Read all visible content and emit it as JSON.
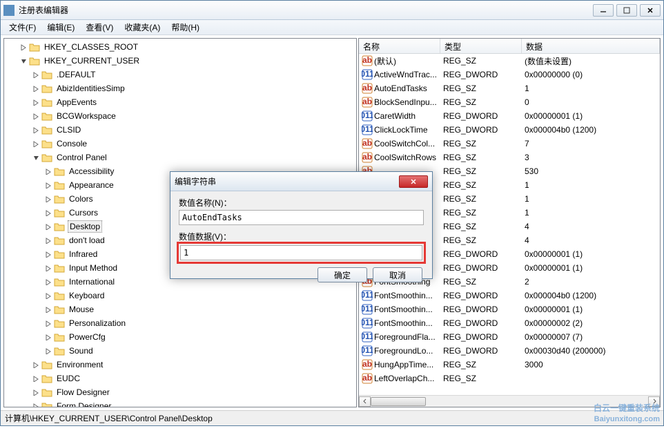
{
  "window": {
    "title": "注册表编辑器"
  },
  "menu": {
    "file": "文件(F)",
    "edit": "编辑(E)",
    "view": "查看(V)",
    "favorites": "收藏夹(A)",
    "help": "帮助(H)"
  },
  "tree": {
    "root1": "HKEY_CLASSES_ROOT",
    "root2": "HKEY_CURRENT_USER",
    "items": [
      ".DEFAULT",
      "AbizIdentitiesSimp",
      "AppEvents",
      "BCGWorkspace",
      "CLSID",
      "Console",
      "Control Panel"
    ],
    "cp_children": [
      "Accessibility",
      "Appearance",
      "Colors",
      "Cursors",
      "Desktop",
      "don't load",
      "Infrared",
      "Input Method",
      "International",
      "Keyboard",
      "Mouse",
      "Personalization",
      "PowerCfg",
      "Sound"
    ],
    "after_cp": [
      "Environment",
      "EUDC",
      "Flow Designer",
      "Form Designer"
    ],
    "selected": "Desktop"
  },
  "columns": {
    "name": "名称",
    "type": "类型",
    "data": "数据"
  },
  "rows": [
    {
      "icon": "sz",
      "name": "(默认)",
      "type": "REG_SZ",
      "data": "(数值未设置)"
    },
    {
      "icon": "dw",
      "name": "ActiveWndTrac...",
      "type": "REG_DWORD",
      "data": "0x00000000 (0)"
    },
    {
      "icon": "sz",
      "name": "AutoEndTasks",
      "type": "REG_SZ",
      "data": "1"
    },
    {
      "icon": "sz",
      "name": "BlockSendInpu...",
      "type": "REG_SZ",
      "data": "0"
    },
    {
      "icon": "dw",
      "name": "CaretWidth",
      "type": "REG_DWORD",
      "data": "0x00000001 (1)"
    },
    {
      "icon": "dw",
      "name": "ClickLockTime",
      "type": "REG_DWORD",
      "data": "0x000004b0 (1200)"
    },
    {
      "icon": "sz",
      "name": "CoolSwitchCol...",
      "type": "REG_SZ",
      "data": "7"
    },
    {
      "icon": "sz",
      "name": "CoolSwitchRows",
      "type": "REG_SZ",
      "data": "3"
    },
    {
      "icon": "sz",
      "name": "",
      "type": "REG_SZ",
      "data": "530"
    },
    {
      "icon": "sz",
      "name": "",
      "type": "REG_SZ",
      "data": "1"
    },
    {
      "icon": "sz",
      "name": "",
      "type": "REG_SZ",
      "data": "1"
    },
    {
      "icon": "sz",
      "name": "",
      "type": "REG_SZ",
      "data": "1"
    },
    {
      "icon": "sz",
      "name": "",
      "type": "REG_SZ",
      "data": "4"
    },
    {
      "icon": "sz",
      "name": "",
      "type": "REG_SZ",
      "data": "4"
    },
    {
      "icon": "dw",
      "name": "",
      "type": "REG_DWORD",
      "data": "0x00000001 (1)"
    },
    {
      "icon": "dw",
      "name": "",
      "type": "REG_DWORD",
      "data": "0x00000001 (1)"
    },
    {
      "icon": "sz",
      "name": "FontSmoothing",
      "type": "REG_SZ",
      "data": "2"
    },
    {
      "icon": "dw",
      "name": "FontSmoothin...",
      "type": "REG_DWORD",
      "data": "0x000004b0 (1200)"
    },
    {
      "icon": "dw",
      "name": "FontSmoothin...",
      "type": "REG_DWORD",
      "data": "0x00000001 (1)"
    },
    {
      "icon": "dw",
      "name": "FontSmoothin...",
      "type": "REG_DWORD",
      "data": "0x00000002 (2)"
    },
    {
      "icon": "dw",
      "name": "ForegroundFla...",
      "type": "REG_DWORD",
      "data": "0x00000007 (7)"
    },
    {
      "icon": "dw",
      "name": "ForegroundLo...",
      "type": "REG_DWORD",
      "data": "0x00030d40 (200000)"
    },
    {
      "icon": "sz",
      "name": "HungAppTime...",
      "type": "REG_SZ",
      "data": "3000"
    },
    {
      "icon": "sz",
      "name": "LeftOverlapCh...",
      "type": "REG_SZ",
      "data": ""
    }
  ],
  "dialog": {
    "title": "编辑字符串",
    "name_label": "数值名称(N)：",
    "name_value": "AutoEndTasks",
    "data_label": "数值数据(V)：",
    "data_value": "1",
    "ok": "确定",
    "cancel": "取消"
  },
  "statusbar": "计算机\\HKEY_CURRENT_USER\\Control Panel\\Desktop",
  "watermark": {
    "line1": "白云一键重装系统",
    "line2": "Baiyunxitong.com"
  }
}
